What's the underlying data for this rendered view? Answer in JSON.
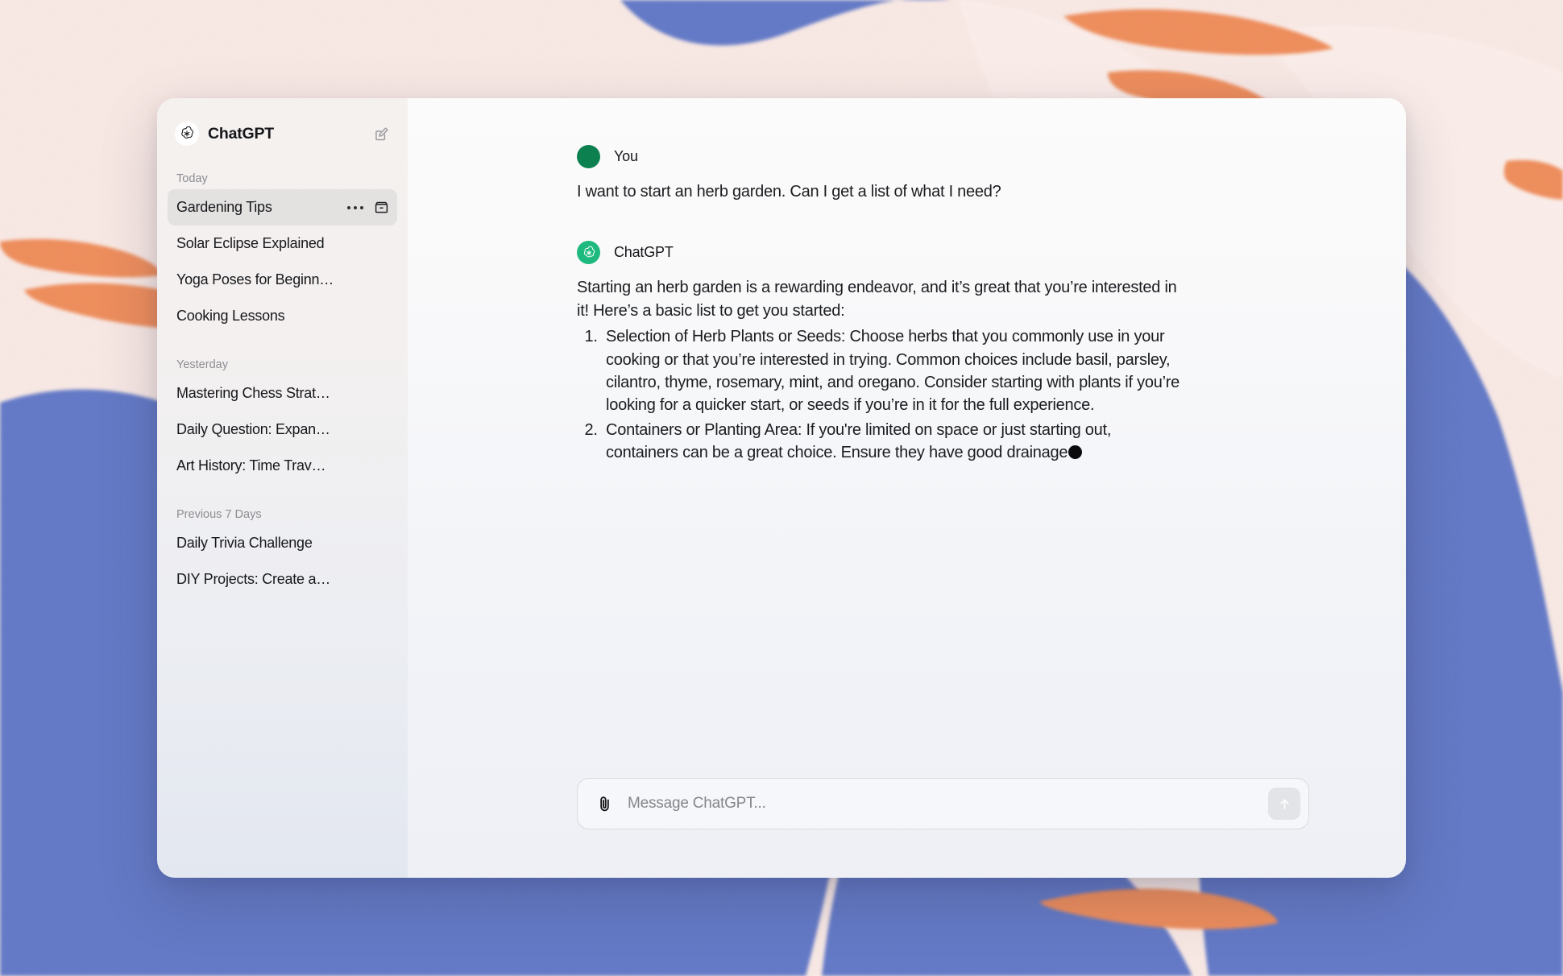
{
  "window": {
    "brand": "ChatGPT",
    "new_chat_icon": "compose-pencil-square-icon"
  },
  "sidebar": {
    "groups": [
      {
        "label": "Today",
        "items": [
          {
            "title": "Gardening Tips",
            "active": true
          },
          {
            "title": "Solar Eclipse Explained",
            "active": false
          },
          {
            "title": "Yoga Poses for Beginn…",
            "active": false
          },
          {
            "title": "Cooking Lessons",
            "active": false
          }
        ]
      },
      {
        "label": "Yesterday",
        "items": [
          {
            "title": "Mastering Chess Strat…",
            "active": false
          },
          {
            "title": "Daily Question: Expan…",
            "active": false
          },
          {
            "title": "Art History: Time Trav…",
            "active": false
          }
        ]
      },
      {
        "label": "Previous 7 Days",
        "items": [
          {
            "title": "Daily Trivia Challenge",
            "active": false
          },
          {
            "title": "DIY Projects: Create a…",
            "active": false
          }
        ]
      }
    ],
    "row_actions": {
      "more_icon": "ellipsis-icon",
      "archive_icon": "archive-box-icon"
    }
  },
  "conversation": [
    {
      "author": "You",
      "avatar": "user-avatar",
      "text": "I want to start an herb garden. Can I get a list of what I need?",
      "list": []
    },
    {
      "author": "ChatGPT",
      "avatar": "chatgpt-logo-avatar",
      "text": "Starting an herb garden is a rewarding endeavor, and it’s great that you’re interested in it! Here’s a basic list to get you started:",
      "list": [
        "Selection of Herb Plants or Seeds: Choose herbs that you commonly use in your cooking or that you’re interested in trying. Common choices include basil, parsley, cilantro, thyme, rosemary, mint, and oregano. Consider starting with plants if you’re looking for a quicker start, or seeds if you’re in it for the full experience.",
        "Containers or Planting Area: If you're limited on space or just starting out, containers can be a great choice. Ensure they have good drainage"
      ],
      "streaming": true
    }
  ],
  "composer": {
    "attach_icon": "paperclip-icon",
    "placeholder": "Message ChatGPT...",
    "value": "",
    "send_icon": "arrow-up-icon",
    "send_label": "Send"
  },
  "colors": {
    "brand_green": "#1eb97e",
    "user_green": "#0d8050",
    "wallpaper_pink": "#f7e6e2",
    "wallpaper_orange": "#ef8f5d",
    "wallpaper_blue": "#6479c6"
  }
}
